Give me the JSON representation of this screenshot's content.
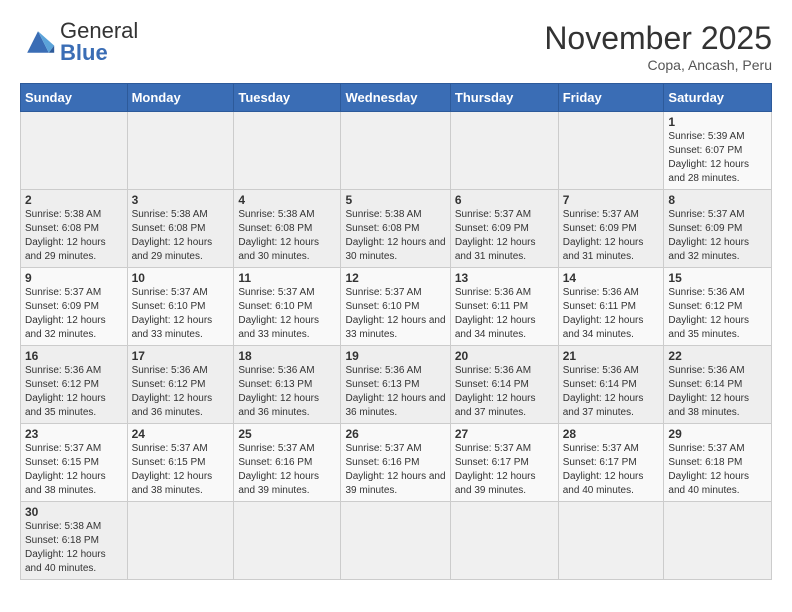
{
  "logo": {
    "text_general": "General",
    "text_blue": "Blue"
  },
  "title": "November 2025",
  "location": "Copa, Ancash, Peru",
  "weekdays": [
    "Sunday",
    "Monday",
    "Tuesday",
    "Wednesday",
    "Thursday",
    "Friday",
    "Saturday"
  ],
  "weeks": [
    [
      {
        "day": "",
        "info": ""
      },
      {
        "day": "",
        "info": ""
      },
      {
        "day": "",
        "info": ""
      },
      {
        "day": "",
        "info": ""
      },
      {
        "day": "",
        "info": ""
      },
      {
        "day": "",
        "info": ""
      },
      {
        "day": "1",
        "info": "Sunrise: 5:39 AM\nSunset: 6:07 PM\nDaylight: 12 hours and 28 minutes."
      }
    ],
    [
      {
        "day": "2",
        "info": "Sunrise: 5:38 AM\nSunset: 6:08 PM\nDaylight: 12 hours and 29 minutes."
      },
      {
        "day": "3",
        "info": "Sunrise: 5:38 AM\nSunset: 6:08 PM\nDaylight: 12 hours and 29 minutes."
      },
      {
        "day": "4",
        "info": "Sunrise: 5:38 AM\nSunset: 6:08 PM\nDaylight: 12 hours and 30 minutes."
      },
      {
        "day": "5",
        "info": "Sunrise: 5:38 AM\nSunset: 6:08 PM\nDaylight: 12 hours and 30 minutes."
      },
      {
        "day": "6",
        "info": "Sunrise: 5:37 AM\nSunset: 6:09 PM\nDaylight: 12 hours and 31 minutes."
      },
      {
        "day": "7",
        "info": "Sunrise: 5:37 AM\nSunset: 6:09 PM\nDaylight: 12 hours and 31 minutes."
      },
      {
        "day": "8",
        "info": "Sunrise: 5:37 AM\nSunset: 6:09 PM\nDaylight: 12 hours and 32 minutes."
      }
    ],
    [
      {
        "day": "9",
        "info": "Sunrise: 5:37 AM\nSunset: 6:09 PM\nDaylight: 12 hours and 32 minutes."
      },
      {
        "day": "10",
        "info": "Sunrise: 5:37 AM\nSunset: 6:10 PM\nDaylight: 12 hours and 33 minutes."
      },
      {
        "day": "11",
        "info": "Sunrise: 5:37 AM\nSunset: 6:10 PM\nDaylight: 12 hours and 33 minutes."
      },
      {
        "day": "12",
        "info": "Sunrise: 5:37 AM\nSunset: 6:10 PM\nDaylight: 12 hours and 33 minutes."
      },
      {
        "day": "13",
        "info": "Sunrise: 5:36 AM\nSunset: 6:11 PM\nDaylight: 12 hours and 34 minutes."
      },
      {
        "day": "14",
        "info": "Sunrise: 5:36 AM\nSunset: 6:11 PM\nDaylight: 12 hours and 34 minutes."
      },
      {
        "day": "15",
        "info": "Sunrise: 5:36 AM\nSunset: 6:12 PM\nDaylight: 12 hours and 35 minutes."
      }
    ],
    [
      {
        "day": "16",
        "info": "Sunrise: 5:36 AM\nSunset: 6:12 PM\nDaylight: 12 hours and 35 minutes."
      },
      {
        "day": "17",
        "info": "Sunrise: 5:36 AM\nSunset: 6:12 PM\nDaylight: 12 hours and 36 minutes."
      },
      {
        "day": "18",
        "info": "Sunrise: 5:36 AM\nSunset: 6:13 PM\nDaylight: 12 hours and 36 minutes."
      },
      {
        "day": "19",
        "info": "Sunrise: 5:36 AM\nSunset: 6:13 PM\nDaylight: 12 hours and 36 minutes."
      },
      {
        "day": "20",
        "info": "Sunrise: 5:36 AM\nSunset: 6:14 PM\nDaylight: 12 hours and 37 minutes."
      },
      {
        "day": "21",
        "info": "Sunrise: 5:36 AM\nSunset: 6:14 PM\nDaylight: 12 hours and 37 minutes."
      },
      {
        "day": "22",
        "info": "Sunrise: 5:36 AM\nSunset: 6:14 PM\nDaylight: 12 hours and 38 minutes."
      }
    ],
    [
      {
        "day": "23",
        "info": "Sunrise: 5:37 AM\nSunset: 6:15 PM\nDaylight: 12 hours and 38 minutes."
      },
      {
        "day": "24",
        "info": "Sunrise: 5:37 AM\nSunset: 6:15 PM\nDaylight: 12 hours and 38 minutes."
      },
      {
        "day": "25",
        "info": "Sunrise: 5:37 AM\nSunset: 6:16 PM\nDaylight: 12 hours and 39 minutes."
      },
      {
        "day": "26",
        "info": "Sunrise: 5:37 AM\nSunset: 6:16 PM\nDaylight: 12 hours and 39 minutes."
      },
      {
        "day": "27",
        "info": "Sunrise: 5:37 AM\nSunset: 6:17 PM\nDaylight: 12 hours and 39 minutes."
      },
      {
        "day": "28",
        "info": "Sunrise: 5:37 AM\nSunset: 6:17 PM\nDaylight: 12 hours and 40 minutes."
      },
      {
        "day": "29",
        "info": "Sunrise: 5:37 AM\nSunset: 6:18 PM\nDaylight: 12 hours and 40 minutes."
      }
    ],
    [
      {
        "day": "30",
        "info": "Sunrise: 5:38 AM\nSunset: 6:18 PM\nDaylight: 12 hours and 40 minutes."
      },
      {
        "day": "",
        "info": ""
      },
      {
        "day": "",
        "info": ""
      },
      {
        "day": "",
        "info": ""
      },
      {
        "day": "",
        "info": ""
      },
      {
        "day": "",
        "info": ""
      },
      {
        "day": "",
        "info": ""
      }
    ]
  ]
}
